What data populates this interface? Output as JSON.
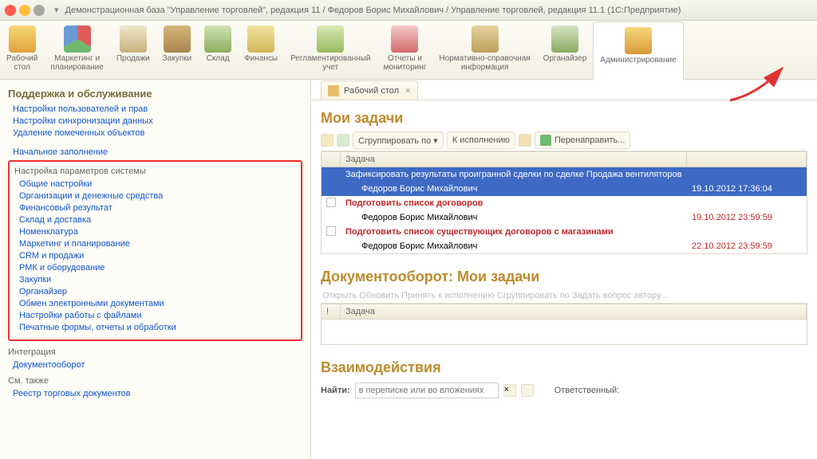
{
  "window": {
    "menu": "▾",
    "title": "Демонстрационная база \"Управление торговлей\", редакция 11 / Федоров Борис Михайлович / Управление торговлей, редакция 11.1  (1С:Предприятие)"
  },
  "toolbar": [
    {
      "label": "Рабочий\nстол"
    },
    {
      "label": "Маркетинг и\nпланирование"
    },
    {
      "label": "Продажи"
    },
    {
      "label": "Закупки"
    },
    {
      "label": "Склад"
    },
    {
      "label": "Финансы"
    },
    {
      "label": "Регламентированный\nучет"
    },
    {
      "label": "Отчеты и\nмониторинг"
    },
    {
      "label": "Нормативно-справочная\nинформация"
    },
    {
      "label": "Органайзер"
    },
    {
      "label": "Администрирование"
    }
  ],
  "sidebar": {
    "heading1": "Поддержка и обслуживание",
    "group1": [
      "Настройки пользователей и прав",
      "Настройки синхронизации данных",
      "Удаление помеченных объектов"
    ],
    "link_initial": "Начальное заполнение",
    "heading2": "Настройка параметров системы",
    "group2": [
      "Общие настройки",
      "Организации и денежные средства",
      "Финансовый результат",
      "Склад и доставка",
      "Номенклатура",
      "Маркетинг и планирование",
      "CRM и продажи",
      "РМК и оборудование",
      "Закупки",
      "Органайзер",
      "Обмен электронными документами",
      "Настройки работы с файлами",
      "Печатные формы, отчеты и обработки"
    ],
    "heading3": "Интеграция",
    "link_integ": "Документооборот",
    "heading4": "См. также",
    "link_see": "Реестр торговых документов"
  },
  "tab": {
    "label": "Рабочий стол",
    "close": "×"
  },
  "my_tasks": {
    "title": "Мои задачи",
    "btn_group": "Сгруппировать по ▾",
    "btn_exec": "К исполнению",
    "btn_redirect": "Перенаправить...",
    "col_task": "Задача",
    "rows": [
      {
        "task": "Зафиксировать результаты проигранной сделки по сделке Продажа вентиляторов",
        "date": "",
        "sel": true,
        "child": false
      },
      {
        "task": "Федоров Борис Михайлович",
        "date": "19.10.2012 17:36:04",
        "sel": true,
        "child": true
      },
      {
        "task": "Подготовить список договоров",
        "date": "",
        "red": true,
        "child": false,
        "check": true
      },
      {
        "task": "Федоров Борис Михайлович",
        "date": "19.10.2012 23:59:59",
        "red2": true,
        "child": true
      },
      {
        "task": "Подготовить список существующих договоров с магазинами",
        "date": "",
        "red": true,
        "child": false,
        "check": true
      },
      {
        "task": "Федоров Борис Михайлович",
        "date": "22.10.2012 23:59:59",
        "red2": true,
        "child": true
      }
    ]
  },
  "docflow": {
    "title": "Документооборот: Мои задачи",
    "faded": "Открыть    Обновить    Принять к исполнению    Сгруппировать по    Задать вопрос автору...",
    "col_task": "Задача",
    "col_flag": "!"
  },
  "interactions": {
    "title": "Взаимодействия",
    "find_label": "Найти:",
    "find_placeholder": "в переписке или во вложениях",
    "resp_label": "Ответственный:"
  }
}
